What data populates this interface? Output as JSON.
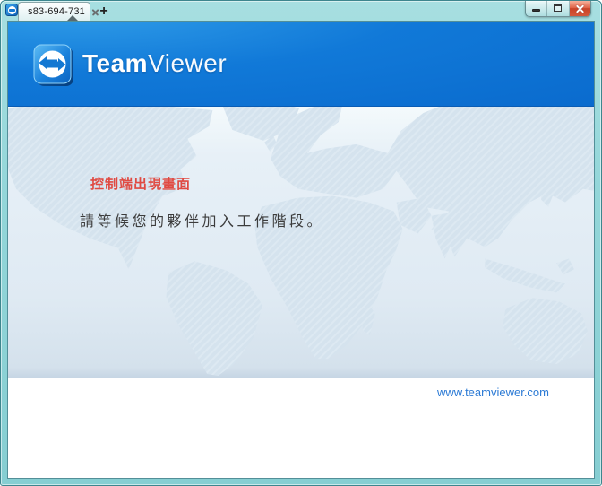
{
  "titlebar": {
    "tab_label": "s83-694-731",
    "new_tab_label": "+"
  },
  "window_controls": {
    "minimize": "minimize",
    "maximize": "maximize",
    "close": "close"
  },
  "header": {
    "brand_bold": "Team",
    "brand_light": "Viewer"
  },
  "main": {
    "heading": "控制端出現畫面",
    "message": "請等候您的夥伴加入工作階段。"
  },
  "footer": {
    "link": "www.teamviewer.com"
  },
  "colors": {
    "frame_teal": "#93d6d9",
    "header_blue": "#0e72d3",
    "heading_red": "#e04a42",
    "message_gray": "#3c3c3c",
    "link_blue": "#2d7bd5",
    "map_land": "#d5e3ee",
    "map_sea": "#e7f0f7"
  }
}
